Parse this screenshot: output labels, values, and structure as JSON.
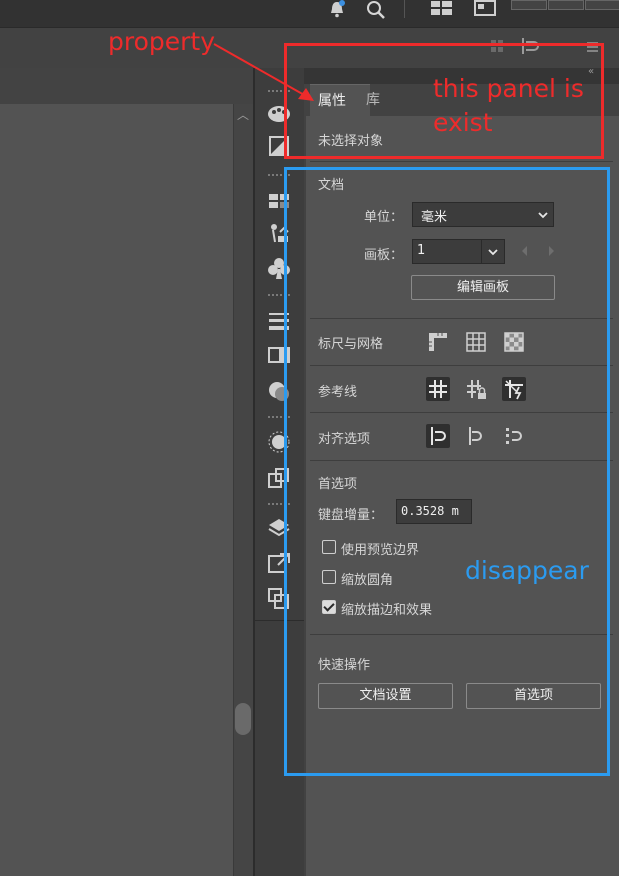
{
  "panel": {
    "tabs": [
      {
        "label": "属性"
      },
      {
        "label": "库"
      }
    ],
    "no_selection": "未选择对象",
    "document": {
      "title": "文档",
      "units_label": "单位：",
      "units_value": "毫米",
      "artboard_label": "画板：",
      "artboard_value": "1",
      "edit_artboards_button": "编辑画板"
    },
    "rulers_grids": {
      "label": "标尺与网格"
    },
    "guides": {
      "label": "参考线"
    },
    "snap_options": {
      "label": "对齐选项"
    },
    "preferences": {
      "title": "首选项",
      "keyboard_increment_label": "键盘增量：",
      "keyboard_increment_value": "0.3528 m",
      "checkboxes": [
        {
          "label": "使用预览边界",
          "checked": false
        },
        {
          "label": "缩放圆角",
          "checked": false
        },
        {
          "label": "缩放描边和效果",
          "checked": true
        }
      ]
    },
    "quick_actions": {
      "title": "快速操作",
      "doc_setup_button": "文档设置",
      "preferences_button": "首选项"
    }
  },
  "annotations": {
    "arrow_label": "property",
    "red_box_text_line1": "this panel is",
    "red_box_text_line2": "exist",
    "blue_box_text": "disappear",
    "red_color": "#ee2b2b",
    "blue_color": "#2b9bf0"
  },
  "icons": [
    "bell-icon",
    "search-icon",
    "workspace-icon",
    "panel-toggle-icon",
    "minimize-icon",
    "restore-icon",
    "close-icon",
    "scroll-up-icon",
    "chevron-down-icon",
    "ruler-icon",
    "grid-icon",
    "transparency-grid-icon",
    "guides-icon",
    "lock-guides-icon",
    "smart-guides-icon",
    "snap-point-icon",
    "snap-pixel-icon",
    "snap-glyph-icon",
    "brushes-icon",
    "gradient-icon",
    "swatches-icon",
    "symbols-icon",
    "clubs-icon",
    "stroke-icon",
    "transparency-icon",
    "appearance-icon",
    "graphic-styles-icon",
    "export-icon",
    "layers-icon",
    "artboards-icon",
    "asset-export-icon"
  ]
}
